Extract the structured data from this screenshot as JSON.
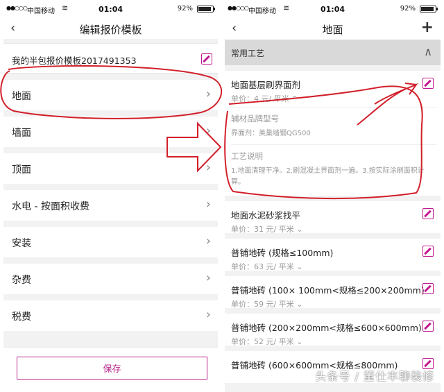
{
  "status": {
    "carrier": "中国移动",
    "time": "01:04",
    "battery": "92%",
    "battery_level": 0.92
  },
  "left": {
    "title": "编辑报价模板",
    "template_name": "我的半包报价模板2017491353",
    "items": [
      "地面",
      "墙面",
      "顶面",
      "水电 - 按面积收费",
      "安装",
      "杂费",
      "税费"
    ],
    "save_label": "保存"
  },
  "right": {
    "title": "地面",
    "section": "常用工艺",
    "first": {
      "name": "地面基层刷界面剂",
      "price": "单价：4 元/ 平米 ^",
      "material_title": "辅材品牌型号",
      "material_value": "界面剂：美巢墙锢QG500",
      "process_title": "工艺说明",
      "process_value": "1.地面清理干净。2.刷混凝土界面剂一遍。3.按实际涂刷面积计算。"
    },
    "items": [
      {
        "name": "地面水泥砂浆找平",
        "price": "单价：31 元/ 平米 ⌄"
      },
      {
        "name": "普铺地砖 (规格≤100mm)",
        "price": "单价：63 元/ 平米 ⌄"
      },
      {
        "name": "普铺地砖 (100× 100mm<规格≤200×200mm)",
        "price": "单价：59 元/ 平米 ⌄"
      },
      {
        "name": "普铺地砖 (200×200mm<规格≤600×600mm)",
        "price": "单价：52 元/ 平米 ⌄"
      },
      {
        "name": "普铺地砖 (600×600mm<规格≤800mm)",
        "price": ""
      }
    ]
  },
  "watermark": "头条号 / 董仕丰聊装修",
  "annotation_color": "#d21f2a",
  "accent_color": "#c2188f"
}
